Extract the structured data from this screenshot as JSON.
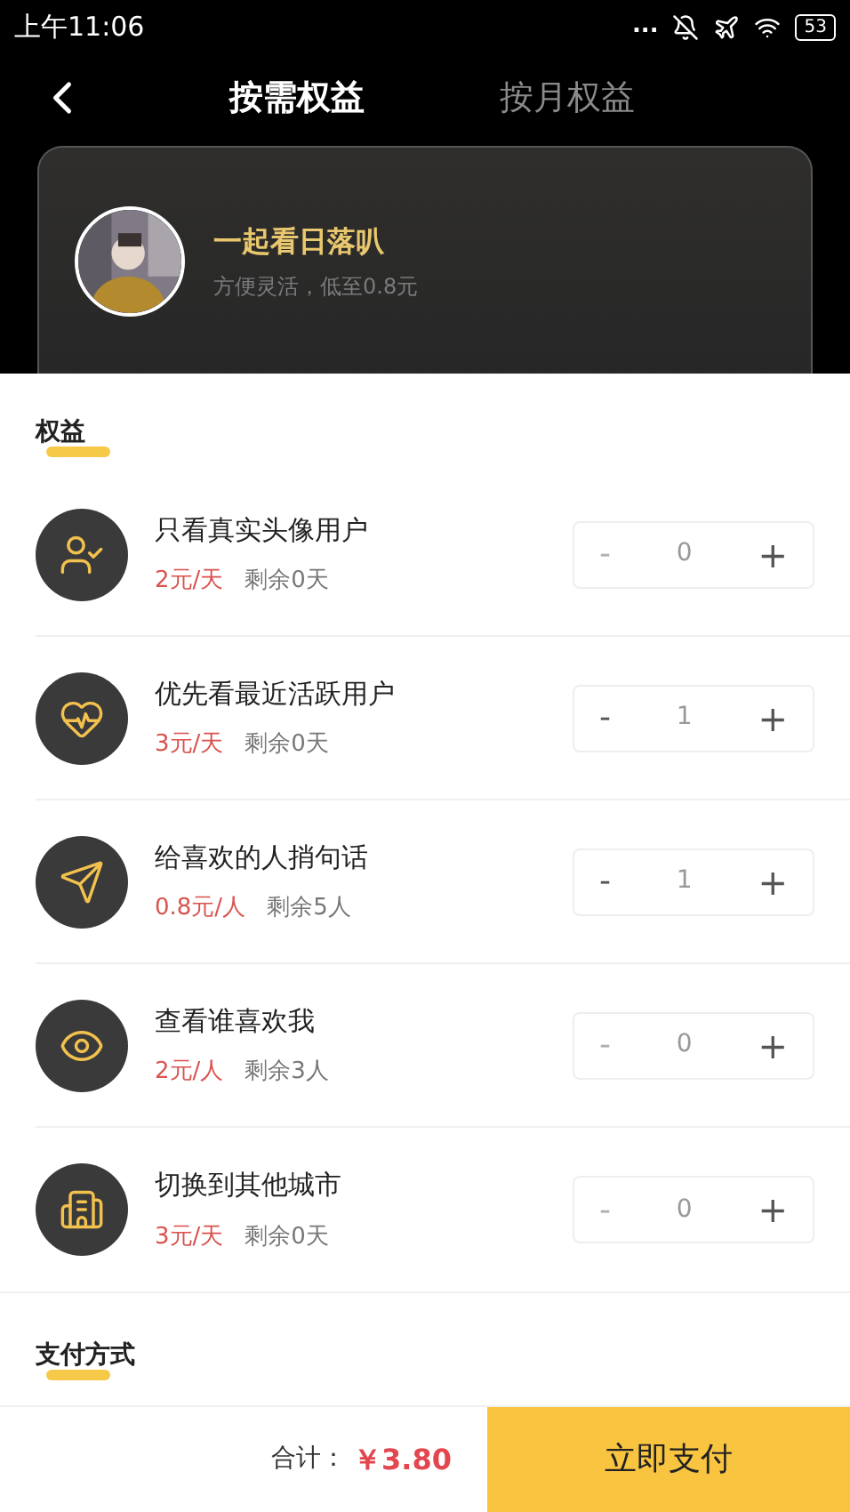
{
  "status_bar": {
    "time": "上午11:06",
    "dots": "...",
    "battery": "53"
  },
  "tabs": [
    {
      "label": "按需权益",
      "selected": true
    },
    {
      "label": "按月权益",
      "selected": false
    }
  ],
  "profile": {
    "name": "一起看日落叭",
    "subtitle": "方便灵活，低至0.8元"
  },
  "benefits_title": "权益",
  "benefits": [
    {
      "title": "只看真实头像用户",
      "price": "2元/天",
      "remaining": "剩余0天",
      "minus": "-",
      "count": "0",
      "plus": "+",
      "can_decrease": false
    },
    {
      "title": "优先看最近活跃用户",
      "price": "3元/天",
      "remaining": "剩余0天",
      "minus": "-",
      "count": "1",
      "plus": "+",
      "can_decrease": true
    },
    {
      "title": "给喜欢的人捎句话",
      "price": "0.8元/人",
      "remaining": "剩余5人",
      "minus": "-",
      "count": "1",
      "plus": "+",
      "can_decrease": true
    },
    {
      "title": "查看谁喜欢我",
      "price": "2元/人",
      "remaining": "剩余3人",
      "minus": "-",
      "count": "0",
      "plus": "+",
      "can_decrease": false
    },
    {
      "title": "切换到其他城市",
      "price": "3元/天",
      "remaining": "剩余0天",
      "minus": "-",
      "count": "0",
      "plus": "+",
      "can_decrease": false
    }
  ],
  "payment_title": "支付方式",
  "footer": {
    "total_label": "合计：",
    "total": "￥3.80",
    "pay_button": "立即支付"
  }
}
